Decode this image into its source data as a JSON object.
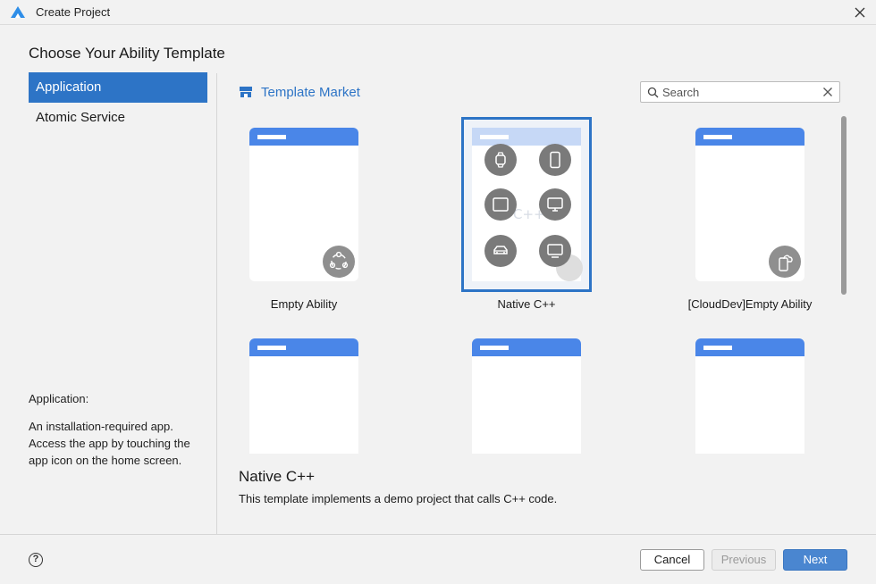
{
  "window": {
    "title": "Create Project"
  },
  "page": {
    "heading": "Choose Your Ability Template"
  },
  "sidebar": {
    "items": [
      {
        "label": "Application",
        "active": true
      },
      {
        "label": "Atomic Service",
        "active": false
      }
    ],
    "description_title": "Application:",
    "description": "An installation-required app. Access the app by touching the app icon on the home screen."
  },
  "market": {
    "label": "Template Market"
  },
  "search": {
    "placeholder": "Search",
    "value": ""
  },
  "templates": [
    {
      "label": "Empty Ability",
      "badge_icon": "empty-ability-icon"
    },
    {
      "label": "Native C++",
      "selected": true,
      "overlay_text": "C++"
    },
    {
      "label": "[CloudDev]Empty Ability",
      "badge_icon": "cloud-device-icon"
    },
    {
      "label": ""
    },
    {
      "label": ""
    },
    {
      "label": ""
    }
  ],
  "selected_template": {
    "name": "Native C++",
    "description": "This template implements a demo project that calls C++ code."
  },
  "footer": {
    "help": "?",
    "cancel": "Cancel",
    "previous": "Previous",
    "next": "Next"
  },
  "colors": {
    "accent": "#2d74c6",
    "header_bar": "#4a86e8",
    "background": "#f2f2f2"
  }
}
